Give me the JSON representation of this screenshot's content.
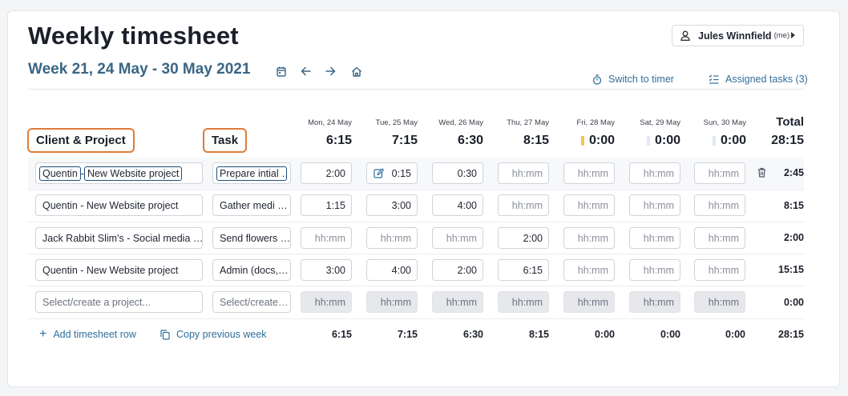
{
  "header": {
    "title": "Weekly timesheet",
    "week_label": "Week 21, 24 May - 30 May 2021",
    "user_name": "Jules Winnfield",
    "user_suffix": "(me)",
    "switch_timer": "Switch to timer",
    "assigned_tasks": "Assigned tasks (3)"
  },
  "columns": {
    "client_project": "Client & Project",
    "task": "Task",
    "total": "Total",
    "grand_total": "28:15"
  },
  "days": [
    {
      "name": "Mon, 24 May",
      "total": "6:15"
    },
    {
      "name": "Tue, 25 May",
      "total": "7:15"
    },
    {
      "name": "Wed, 26 May",
      "total": "6:30"
    },
    {
      "name": "Thu, 27 May",
      "total": "8:15"
    },
    {
      "name": "Fri, 28 May",
      "total": "0:00",
      "indicator_color": "#f2c94c"
    },
    {
      "name": "Sat, 29 May",
      "total": "0:00",
      "indicator_color": "#dfe8f3"
    },
    {
      "name": "Sun, 30 May",
      "total": "0:00",
      "indicator_color": "#dfe8f3"
    }
  ],
  "rows": [
    {
      "project_a": "Quentin",
      "project_b": "New Website project",
      "task": "Prepare intial …",
      "times": [
        "2:00",
        "0:15",
        "0:30",
        "hh:mm",
        "hh:mm",
        "hh:mm",
        "hh:mm"
      ],
      "total": "2:45"
    },
    {
      "project": "Quentin - New Website project",
      "task": "Gather medi …",
      "times": [
        "1:15",
        "3:00",
        "4:00",
        "hh:mm",
        "hh:mm",
        "hh:mm",
        "hh:mm"
      ],
      "total": "8:15"
    },
    {
      "project": "Jack Rabbit Slim's - Social media …",
      "task": "Send flowers …",
      "times": [
        "hh:mm",
        "hh:mm",
        "hh:mm",
        "2:00",
        "hh:mm",
        "hh:mm",
        "hh:mm"
      ],
      "total": "2:00"
    },
    {
      "project": "Quentin - New Website project",
      "task": "Admin (docs,…",
      "times": [
        "3:00",
        "4:00",
        "2:00",
        "6:15",
        "hh:mm",
        "hh:mm",
        "hh:mm"
      ],
      "total": "15:15"
    },
    {
      "project": "Select/create a project...",
      "task": "Select/create…",
      "times": [
        "hh:mm",
        "hh:mm",
        "hh:mm",
        "hh:mm",
        "hh:mm",
        "hh:mm",
        "hh:mm"
      ],
      "total": "0:00"
    }
  ],
  "footer": {
    "add_row": "Add timesheet row",
    "copy_week": "Copy previous week",
    "totals": [
      "6:15",
      "7:15",
      "6:30",
      "8:15",
      "0:00",
      "0:00",
      "0:00"
    ],
    "grand_total": "28:15"
  },
  "colors": {
    "accent": "#2f6f9a",
    "week_title": "#3a6685",
    "highlight_orange": "#e07b39",
    "highlight_navy": "#1f4e79"
  }
}
